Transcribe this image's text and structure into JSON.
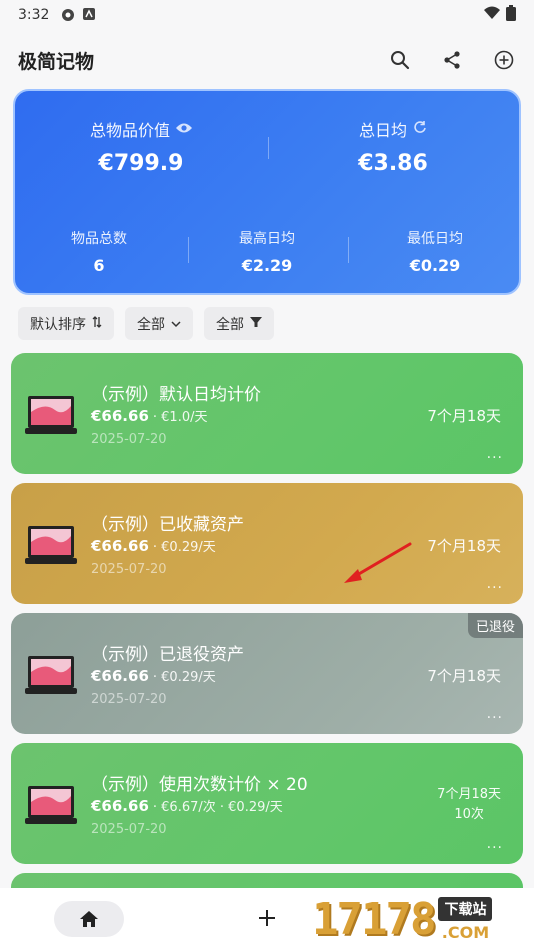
{
  "status_bar": {
    "time": "3:32"
  },
  "app": {
    "title": "极简记物",
    "actions": [
      "search-icon",
      "share-icon",
      "add-circle-icon"
    ]
  },
  "summary": {
    "total_value_label": "总物品价值",
    "total_value": "€799.9",
    "daily_total_label": "总日均",
    "daily_total": "€3.86",
    "count_label": "物品总数",
    "count": "6",
    "max_daily_label": "最高日均",
    "max_daily": "€2.29",
    "min_daily_label": "最低日均",
    "min_daily": "€0.29"
  },
  "filters": [
    {
      "label": "默认排序",
      "icon": "sort-icon"
    },
    {
      "label": "全部",
      "icon": "chevron-down-icon"
    },
    {
      "label": "全部",
      "icon": "filter-icon"
    }
  ],
  "items": [
    {
      "name": "（示例）默认日均计价",
      "price": "€66.66",
      "sub": "· €1.0/天",
      "date": "2025-07-20",
      "duration": "7个月18天",
      "more": "...",
      "color": "#63c56b"
    },
    {
      "name": "（示例）已收藏资产",
      "price": "€66.66",
      "sub": "· €0.29/天",
      "date": "2025-07-20",
      "duration": "7个月18天",
      "more": "...",
      "color": "#d0a64e"
    },
    {
      "name": "（示例）已退役资产",
      "price": "€66.66",
      "sub": "· €0.29/天",
      "date": "2025-07-20",
      "duration": "7个月18天",
      "more": "...",
      "badge": "已退役",
      "color": "#9aaba4"
    },
    {
      "name": "（示例）使用次数计价 × 20",
      "price": "€66.66",
      "sub": "· €6.67/次 · €0.29/天",
      "date": "2025-07-20",
      "duration": "7个月18天",
      "duration2": "10次",
      "more": "...",
      "color": "#63c56b"
    }
  ],
  "watermark": {
    "digits": "17178",
    "download": "下载站",
    "domain": ".COM"
  }
}
